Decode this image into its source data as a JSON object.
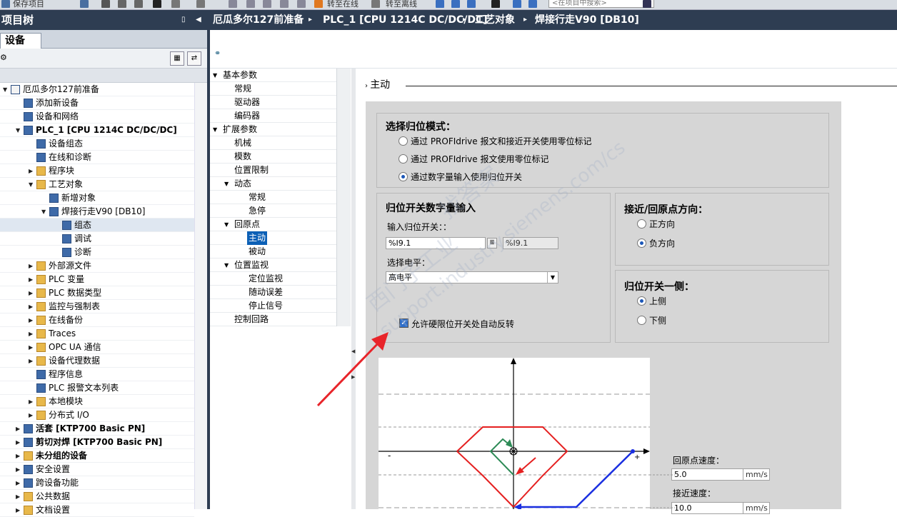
{
  "toolbar": {
    "items": [
      "保存项目",
      "转至在线",
      "转至离线"
    ],
    "search_placeholder": "<在项目中搜索>"
  },
  "project_tree": {
    "title": "项目树",
    "tab": "设备",
    "items": [
      {
        "label": "厄瓜多尔127前准备",
        "level": 0,
        "arrow": "down",
        "icon": "project-icon"
      },
      {
        "label": "添加新设备",
        "level": 1,
        "arrow": "",
        "icon": "add-device-icon"
      },
      {
        "label": "设备和网络",
        "level": 1,
        "arrow": "",
        "icon": "network-icon"
      },
      {
        "label": "PLC_1 [CPU 1214C DC/DC/DC]",
        "level": 1,
        "arrow": "down",
        "icon": "plc-icon",
        "bold": true
      },
      {
        "label": "设备组态",
        "level": 2,
        "arrow": "",
        "icon": "device-config-icon"
      },
      {
        "label": "在线和诊断",
        "level": 2,
        "arrow": "",
        "icon": "online-diag-icon"
      },
      {
        "label": "程序块",
        "level": 2,
        "arrow": "right",
        "icon": "folder-icon"
      },
      {
        "label": "工艺对象",
        "level": 2,
        "arrow": "down",
        "icon": "folder-icon"
      },
      {
        "label": "新增对象",
        "level": 3,
        "arrow": "",
        "icon": "add-object-icon"
      },
      {
        "label": "焊接行走V90 [DB10]",
        "level": 3,
        "arrow": "down",
        "icon": "axis-icon"
      },
      {
        "label": "组态",
        "level": 4,
        "arrow": "",
        "icon": "config-icon",
        "selected": true
      },
      {
        "label": "调试",
        "level": 4,
        "arrow": "",
        "icon": "commissioning-icon"
      },
      {
        "label": "诊断",
        "level": 4,
        "arrow": "",
        "icon": "diagnostics-icon"
      },
      {
        "label": "外部源文件",
        "level": 2,
        "arrow": "right",
        "icon": "folder-icon"
      },
      {
        "label": "PLC 变量",
        "level": 2,
        "arrow": "right",
        "icon": "folder-icon"
      },
      {
        "label": "PLC 数据类型",
        "level": 2,
        "arrow": "right",
        "icon": "folder-icon"
      },
      {
        "label": "监控与强制表",
        "level": 2,
        "arrow": "right",
        "icon": "folder-icon"
      },
      {
        "label": "在线备份",
        "level": 2,
        "arrow": "right",
        "icon": "folder-icon"
      },
      {
        "label": "Traces",
        "level": 2,
        "arrow": "right",
        "icon": "folder-icon"
      },
      {
        "label": "OPC UA 通信",
        "level": 2,
        "arrow": "right",
        "icon": "folder-icon"
      },
      {
        "label": "设备代理数据",
        "level": 2,
        "arrow": "right",
        "icon": "folder-icon"
      },
      {
        "label": "程序信息",
        "level": 2,
        "arrow": "",
        "icon": "program-info-icon"
      },
      {
        "label": "PLC 报警文本列表",
        "level": 2,
        "arrow": "",
        "icon": "alarm-text-icon"
      },
      {
        "label": "本地模块",
        "level": 2,
        "arrow": "right",
        "icon": "folder-icon"
      },
      {
        "label": "分布式 I/O",
        "level": 2,
        "arrow": "right",
        "icon": "folder-icon"
      },
      {
        "label": "活套 [KTP700 Basic PN]",
        "level": 1,
        "arrow": "right",
        "icon": "hmi-icon",
        "bold": true
      },
      {
        "label": "剪切对焊 [KTP700 Basic PN]",
        "level": 1,
        "arrow": "right",
        "icon": "hmi-icon",
        "bold": true
      },
      {
        "label": "未分组的设备",
        "level": 1,
        "arrow": "right",
        "icon": "folder-icon",
        "bold": true
      },
      {
        "label": "安全设置",
        "level": 1,
        "arrow": "right",
        "icon": "security-icon"
      },
      {
        "label": "跨设备功能",
        "level": 1,
        "arrow": "right",
        "icon": "cross-device-icon"
      },
      {
        "label": "公共数据",
        "level": 1,
        "arrow": "right",
        "icon": "folder-icon"
      },
      {
        "label": "文档设置",
        "level": 1,
        "arrow": "right",
        "icon": "folder-icon"
      }
    ]
  },
  "breadcrumb": [
    "厄瓜多尔127前准备",
    "PLC_1 [CPU 1214C DC/DC/DC]",
    "工艺对象",
    "焊接行走V90 [DB10]"
  ],
  "nav": {
    "items": [
      {
        "label": "基本参数",
        "level": 0,
        "arrow": "down",
        "status": "ok"
      },
      {
        "label": "常规",
        "level": 1,
        "arrow": "",
        "status": "ok"
      },
      {
        "label": "驱动器",
        "level": 1,
        "arrow": "",
        "status": "ok"
      },
      {
        "label": "编码器",
        "level": 1,
        "arrow": "",
        "status": "ok"
      },
      {
        "label": "扩展参数",
        "level": 0,
        "arrow": "down",
        "status": "ok"
      },
      {
        "label": "机械",
        "level": 1,
        "arrow": "",
        "status": "ok"
      },
      {
        "label": "模数",
        "level": 1,
        "arrow": "",
        "status": "default"
      },
      {
        "label": "位置限制",
        "level": 1,
        "arrow": "",
        "status": "ok"
      },
      {
        "label": "动态",
        "level": 1,
        "arrow": "down",
        "status": "ok"
      },
      {
        "label": "常规",
        "level": 2,
        "arrow": "",
        "status": "ok"
      },
      {
        "label": "急停",
        "level": 2,
        "arrow": "",
        "status": "ok"
      },
      {
        "label": "回原点",
        "level": 1,
        "arrow": "down",
        "status": "ok"
      },
      {
        "label": "主动",
        "level": 2,
        "arrow": "",
        "status": "ok",
        "selected": true
      },
      {
        "label": "被动",
        "level": 2,
        "arrow": "",
        "status": "default"
      },
      {
        "label": "位置监视",
        "level": 1,
        "arrow": "down",
        "status": "ok"
      },
      {
        "label": "定位监视",
        "level": 2,
        "arrow": "",
        "status": "ok"
      },
      {
        "label": "随动误差",
        "level": 2,
        "arrow": "",
        "status": "ok"
      },
      {
        "label": "停止信号",
        "level": 2,
        "arrow": "",
        "status": "default"
      },
      {
        "label": "控制回路",
        "level": 1,
        "arrow": "",
        "status": "default"
      }
    ]
  },
  "section_title": "主动",
  "homing_mode": {
    "title": "选择归位模式：",
    "options": [
      "通过 PROFIdrive 报文和接近开关使用零位标记",
      "通过 PROFIdrive 报文使用零位标记",
      "通过数字量输入使用归位开关"
    ],
    "selected": 2
  },
  "digital_input": {
    "title": "归位开关数字量输入",
    "input_label": "输入归位开关：：",
    "input_value": "%I9.1",
    "input_readonly": "%I9.1",
    "level_label": "选择电平：",
    "level_value": "高电平",
    "checkbox_label": "允许硬限位开关处自动反转",
    "checkbox_checked": true
  },
  "approach_direction": {
    "title": "接近/回原点方向：",
    "options": [
      "正方向",
      "负方向"
    ],
    "selected": 1
  },
  "switch_side": {
    "title": "归位开关一侧：",
    "options": [
      "上侧",
      "下侧"
    ],
    "selected": 0
  },
  "diagram": {
    "minus_label": "-",
    "plus_label": "+"
  },
  "speed": {
    "homing_label": "回原点速度：",
    "homing_value": "5.0",
    "homing_unit": "mm/s",
    "approach_label": "接近速度：",
    "approach_value": "10.0",
    "approach_unit": "mm/s"
  },
  "watermark": {
    "line1": "找答案",
    "line2": "support.industry.siemens.com/cs",
    "line3": "西门子工业"
  },
  "colors": {
    "titlebar": "#2e3d52",
    "status_ok": "#2eaa2e",
    "status_default": "#2a56c6",
    "selection": "#0c60b6",
    "annotation_arrow": "#e8242a"
  }
}
